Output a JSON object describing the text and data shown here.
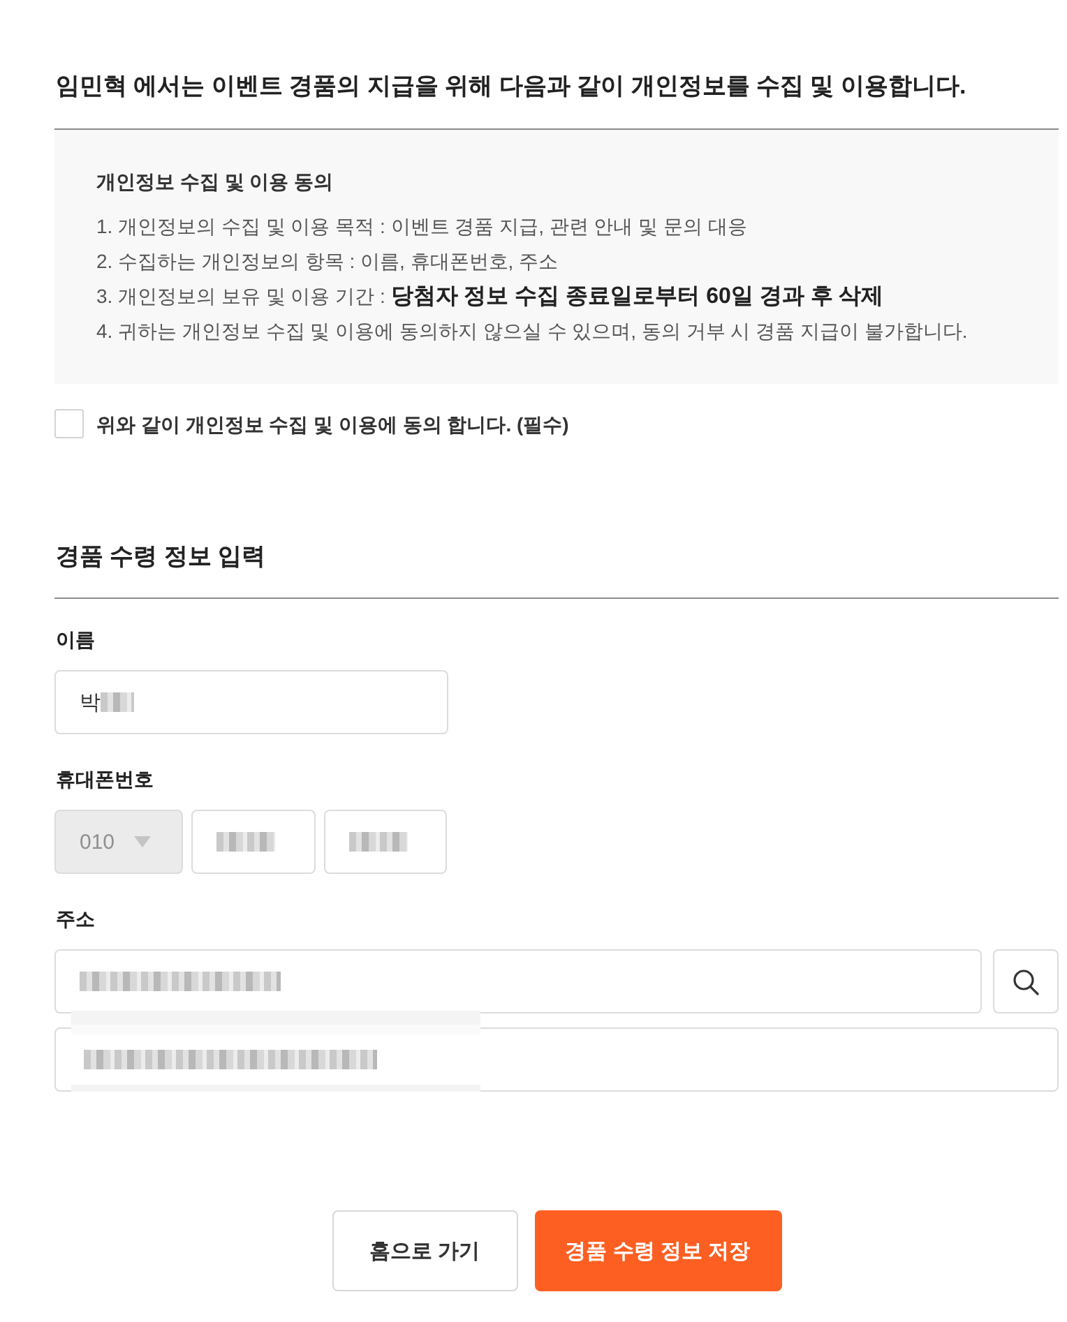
{
  "notice": {
    "heading": "임민혁 에서는 이벤트 경품의 지급을 위해 다음과 같이 개인정보를 수집 및 이용합니다.",
    "title": "개인정보 수집 및 이용 동의",
    "items": [
      "1. 개인정보의 수집 및 이용 목적 : 이벤트 경품 지급, 관련 안내 및 문의 대응",
      "2. 수집하는 개인정보의 항목 : 이름, 휴대폰번호, 주소",
      "3. 개인정보의 보유 및 이용 기간 : **당첨자 정보 수집 종료일로부터 60일 경과 후 삭제**",
      "4. 귀하는 개인정보 수집 및 이용에 동의하지 않으실 수 있으며, 동의 거부 시 경품 지급이 불가합니다."
    ]
  },
  "consent": {
    "label": "위와 같이 개인정보 수집 및 이용에 동의 합니다. (필수)",
    "checked": false
  },
  "form": {
    "title": "경품 수령 정보 입력",
    "fields": [
      {
        "kind": "name",
        "label": "이름",
        "rows": [
          [
            {
              "kind": "text",
              "value": "박",
              "redacted": true
            }
          ]
        ]
      },
      {
        "kind": "phone",
        "label": "휴대폰번호",
        "rows": [
          [
            {
              "kind": "select",
              "value": "010",
              "disabled": true
            },
            {
              "kind": "text",
              "redacted": true
            },
            {
              "kind": "text",
              "redacted": true
            }
          ]
        ]
      },
      {
        "kind": "address",
        "label": "주소",
        "rows": [
          [
            {
              "kind": "text",
              "redacted": true
            },
            {
              "kind": "search"
            }
          ],
          [
            {
              "kind": "text",
              "redacted": true
            }
          ]
        ]
      }
    ]
  },
  "buttons": [
    {
      "kind": "secondary",
      "label": "홈으로 가기"
    },
    {
      "kind": "primary",
      "label": "경품 수령 정보 저장"
    }
  ]
}
